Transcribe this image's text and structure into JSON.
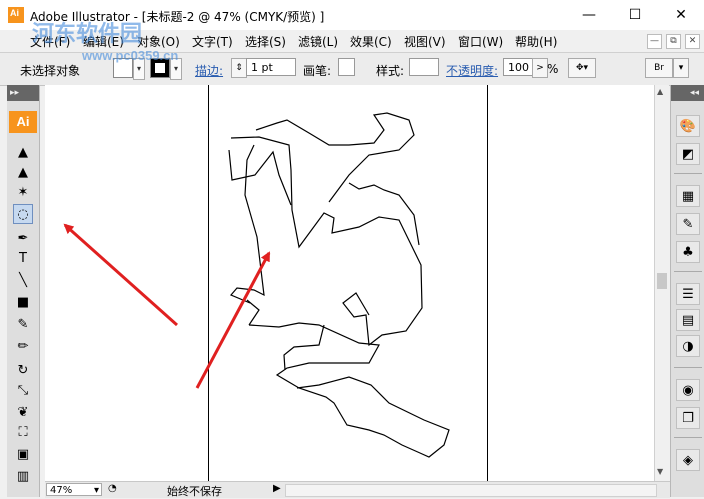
{
  "window": {
    "title": "Adobe Illustrator - [未标题-2 @ 47% (CMYK/预览) ]",
    "app_icon": "Ai",
    "minimize": "—",
    "maximize": "☐",
    "close": "✕"
  },
  "menu": [
    "文件(F)",
    "编辑(E)",
    "对象(O)",
    "文字(T)",
    "选择(S)",
    "滤镜(L)",
    "效果(C)",
    "视图(V)",
    "窗口(W)",
    "帮助(H)"
  ],
  "doc_controls": {
    "minimize": "—",
    "restore": "⧉",
    "close": "✕"
  },
  "control_bar": {
    "selection_status": "未选择对象",
    "stroke_label": "描边:",
    "stroke_weight": "1 pt",
    "brush_label": "画笔:",
    "style_label": "样式:",
    "opacity_label": "不透明度:",
    "opacity_value": "100",
    "percent": "%",
    "more": ">"
  },
  "tools": {
    "logo": "Ai",
    "items": [
      {
        "name": "selection-tool-icon",
        "glyph": "▲"
      },
      {
        "name": "direct-selection-tool-icon",
        "glyph": "▲"
      },
      {
        "name": "magic-wand-tool-icon",
        "glyph": "✶"
      },
      {
        "name": "lasso-tool-icon",
        "glyph": "◌"
      },
      {
        "name": "pen-tool-icon",
        "glyph": "✒"
      },
      {
        "name": "type-tool-icon",
        "glyph": "T"
      },
      {
        "name": "line-tool-icon",
        "glyph": "╲"
      },
      {
        "name": "rectangle-tool-icon",
        "glyph": "■"
      },
      {
        "name": "paintbrush-tool-icon",
        "glyph": "✎"
      },
      {
        "name": "pencil-tool-icon",
        "glyph": "✏"
      },
      {
        "name": "rotate-tool-icon",
        "glyph": "↻"
      },
      {
        "name": "scale-tool-icon",
        "glyph": "⤡"
      },
      {
        "name": "warp-tool-icon",
        "glyph": "❦"
      },
      {
        "name": "free-transform-tool-icon",
        "glyph": "⛶"
      },
      {
        "name": "symbol-sprayer-tool-icon",
        "glyph": "▣"
      },
      {
        "name": "column-graph-tool-icon",
        "glyph": "▥"
      }
    ],
    "selected_tool": "lasso-tool-icon",
    "panel_grip": "▸▸"
  },
  "right_panels": {
    "grip": "◂◂",
    "items": [
      {
        "name": "color-panel-icon",
        "glyph": "🎨"
      },
      {
        "name": "color-guide-panel-icon",
        "glyph": "◩"
      },
      {
        "name": "swatches-panel-icon",
        "glyph": "▦"
      },
      {
        "name": "brushes-panel-icon",
        "glyph": "✎"
      },
      {
        "name": "symbols-panel-icon",
        "glyph": "♣"
      },
      {
        "name": "stroke-panel-icon",
        "glyph": "☰"
      },
      {
        "name": "gradient-panel-icon",
        "glyph": "▤"
      },
      {
        "name": "transparency-panel-icon",
        "glyph": "◑"
      },
      {
        "name": "appearance-panel-icon",
        "glyph": "◉"
      },
      {
        "name": "graphic-styles-panel-icon",
        "glyph": "❐"
      },
      {
        "name": "layers-panel-icon",
        "glyph": "◈"
      }
    ]
  },
  "status_bar": {
    "zoom": "47%",
    "status_text": "始终不保存",
    "arrow": "▶",
    "zoom_dropdown": "▾",
    "nav_icon": "◔"
  },
  "watermark": {
    "title": "河东软件园",
    "url": "www.pc0359.cn"
  },
  "colors": {
    "accent_orange": "#f7941d",
    "arrow_red": "#e02020",
    "link_blue": "#2a5db0"
  }
}
